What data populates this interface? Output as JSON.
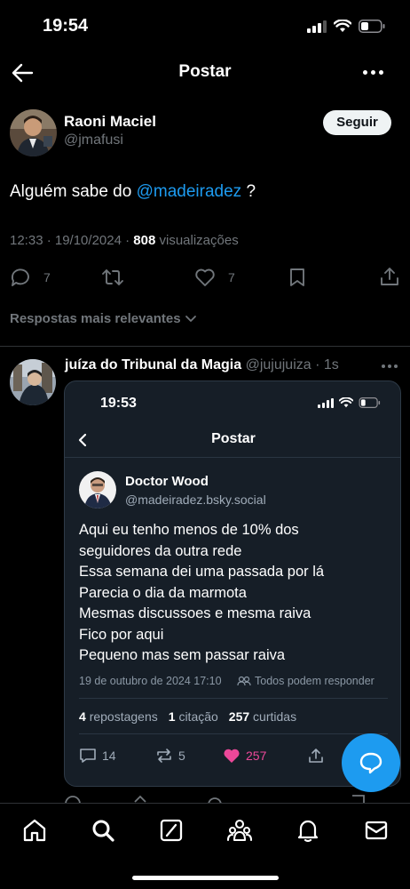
{
  "status_bar": {
    "time": "19:54"
  },
  "header": {
    "title": "Postar"
  },
  "post": {
    "author_name": "Raoni Maciel",
    "author_handle": "@jmafusi",
    "follow_label": "Seguir",
    "text_prefix": "Alguém sabe do ",
    "mention": "@madeiradez",
    "text_suffix": " ?",
    "timestamp": "12:33 · 19/10/2024 · ",
    "views_count": "808",
    "views_label": " visualizações",
    "replies": "7",
    "likes": "7"
  },
  "sort_label": "Respostas mais relevantes",
  "reply": {
    "author_name": "juíza do Tribunal da Magia",
    "author_handle": "@jujujuiza · 1s"
  },
  "embedded": {
    "time": "19:53",
    "title": "Postar",
    "author_name": "Doctor Wood",
    "author_handle": "@madeiradez.bsky.social",
    "lines": [
      "Aqui eu tenho menos de 10% dos",
      "seguidores da outra rede",
      "Essa semana dei uma passada por lá",
      "Parecia o dia da marmota",
      "Mesmas discussoes e mesma raiva",
      "Fico por aqui",
      "Pequeno mas sem passar raiva"
    ],
    "date": "19 de outubro de 2024 17:10",
    "who_can_reply": "Todos podem responder",
    "reposts_count": "4",
    "reposts_label": "repostagens",
    "quotes_count": "1",
    "quotes_label": "citação",
    "likes_count": "257",
    "likes_label": "curtidas",
    "action_replies": "14",
    "action_reposts": "5",
    "action_likes": "257"
  },
  "colors": {
    "accent": "#1d9bf0",
    "background": "#000000",
    "muted": "#71767b",
    "like_pink": "#ec4899"
  }
}
